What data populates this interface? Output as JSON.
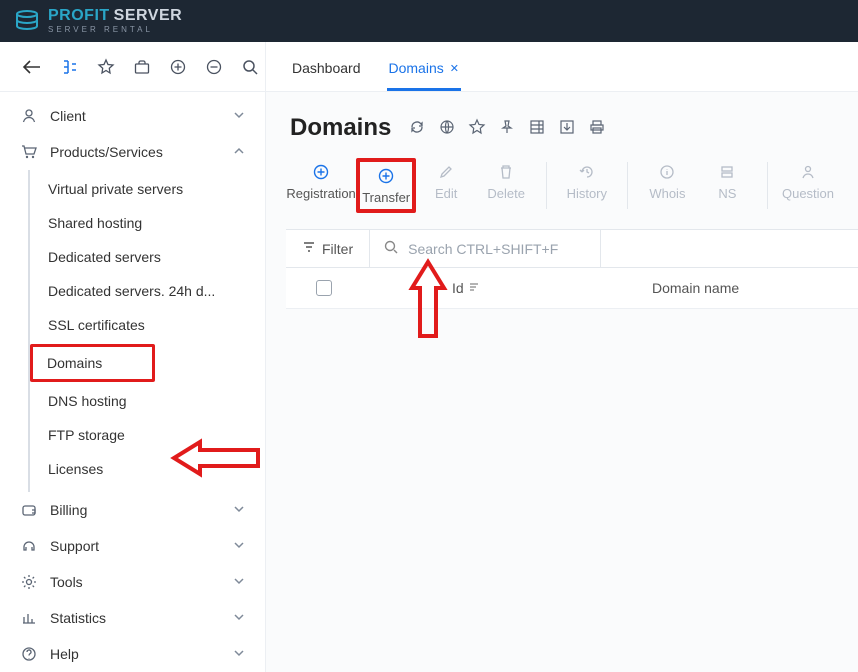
{
  "brand": {
    "name_part1": "PROFIT",
    "name_part2": "SERVER",
    "tagline": "SERVER RENTAL"
  },
  "tabs": [
    {
      "label": "Dashboard",
      "active": false
    },
    {
      "label": "Domains",
      "active": true
    }
  ],
  "page_title": "Domains",
  "toolbar": {
    "registration": "Registration",
    "transfer": "Transfer",
    "edit": "Edit",
    "delete": "Delete",
    "history": "History",
    "whois": "Whois",
    "ns": "NS",
    "question": "Question"
  },
  "filter_label": "Filter",
  "search_placeholder": "Search CTRL+SHIFT+F",
  "columns": {
    "id": "Id",
    "domain": "Domain name"
  },
  "nav": {
    "client": "Client",
    "products": "Products/Services",
    "products_items": [
      "Virtual private servers",
      "Shared hosting",
      "Dedicated servers",
      "Dedicated servers. 24h d...",
      "SSL certificates",
      "Domains",
      "DNS hosting",
      "FTP storage",
      "Licenses"
    ],
    "billing": "Billing",
    "support": "Support",
    "tools": "Tools",
    "statistics": "Statistics",
    "help": "Help"
  }
}
